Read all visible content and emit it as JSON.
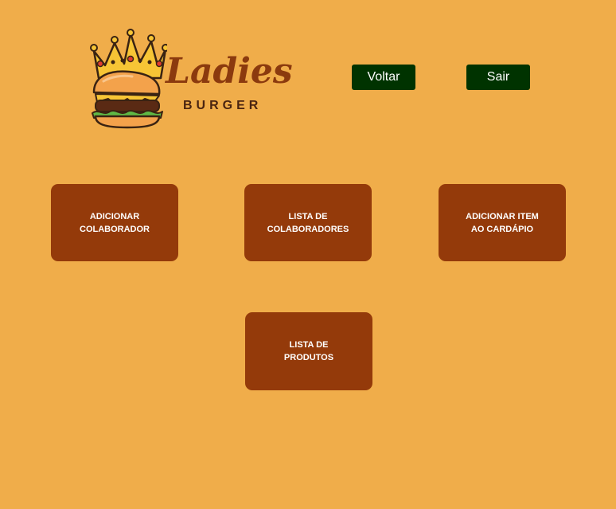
{
  "logo": {
    "title": "Ladies",
    "subtitle": "BURGER",
    "icon": "crowned-burger-icon"
  },
  "nav": {
    "back_label": "Voltar",
    "exit_label": "Sair"
  },
  "cards": [
    {
      "line1": "ADICIONAR",
      "line2": "COLABORADOR"
    },
    {
      "line1": "LISTA DE",
      "line2": "COLABORADORES"
    },
    {
      "line1": "ADICIONAR ITEM",
      "line2": "AO CARDÁPIO"
    },
    {
      "line1": "LISTA DE",
      "line2": "PRODUTOS"
    }
  ],
  "colors": {
    "background": "#f0ad4a",
    "card": "#943a0a",
    "nav_button": "#003300",
    "brand": "#8b3a0e"
  }
}
